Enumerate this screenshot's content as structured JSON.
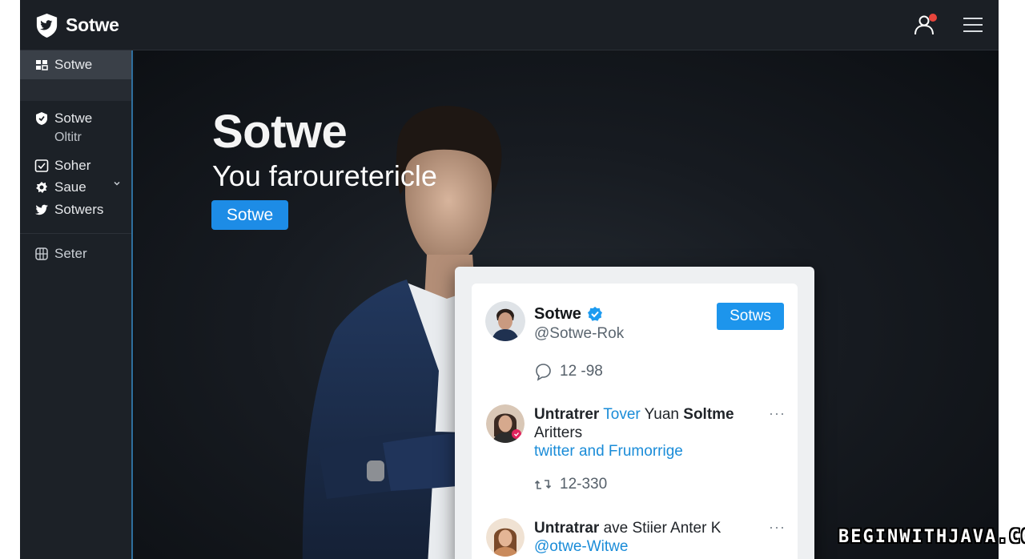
{
  "header": {
    "brand": "Sotwe",
    "icons": [
      "twitter-shield-logo",
      "user-notification-icon",
      "hamburger-menu-icon"
    ],
    "notification_dot_color": "#e8453c"
  },
  "sidebar": {
    "items": [
      {
        "label": "Sotwe",
        "icon": "grid-icon",
        "active": true
      },
      {
        "label": "Sotwe",
        "icon": "shield-icon",
        "sub": "Oltitr"
      },
      {
        "label": "Soher",
        "icon": "check-square-icon"
      },
      {
        "label": "Saue",
        "icon": "gear-icon",
        "chevron": "chevron-down-icon"
      },
      {
        "label": "Sotwers",
        "icon": "bird-icon"
      },
      {
        "label": "Seter",
        "icon": "sliders-icon"
      }
    ]
  },
  "hero": {
    "title": "Sotwe",
    "subtitle": "You farouretericle",
    "button": "Sotwe"
  },
  "card": {
    "profile": {
      "name": "Sotwe",
      "handle": "@Sotwe-Rok",
      "button": "Sotws"
    },
    "stat1": "12 -98",
    "item1": {
      "part1": "Untratrer",
      "part2": "Tover",
      "part3": "Yuan",
      "part4": "Soltme",
      "line2": "Aritters",
      "line3": "twitter and Frumorrige"
    },
    "stat2": "12-330",
    "item2": {
      "line1": "Untratrar",
      "line1b": "ave Stiier Anter K",
      "line2": "@otwe-Witwe"
    },
    "more": "···"
  },
  "watermark": "BEGINWITHJAVA.COM",
  "colors": {
    "accent": "#1d8ce6",
    "sidebar": "#1c2127",
    "topbar": "#1b1f25"
  }
}
